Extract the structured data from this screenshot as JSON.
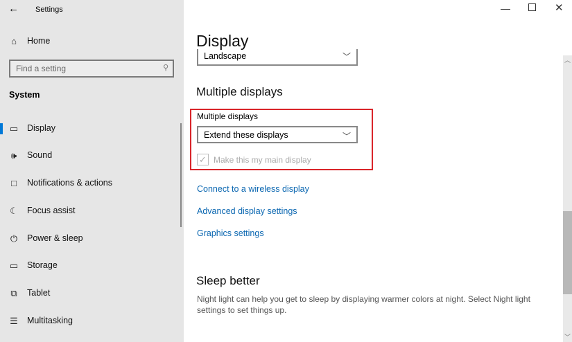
{
  "window": {
    "title": "Settings",
    "back_icon": "arrow-left-icon",
    "minimize_icon": "minimize-icon",
    "maximize_icon": "maximize-icon",
    "close_icon": "close-icon"
  },
  "sidebar": {
    "home": "Home",
    "search_placeholder": "Find a setting",
    "section": "System",
    "items": [
      {
        "label": "Display",
        "icon": "monitor-icon",
        "selected": true
      },
      {
        "label": "Sound",
        "icon": "speaker-icon"
      },
      {
        "label": "Notifications & actions",
        "icon": "notification-icon"
      },
      {
        "label": "Focus assist",
        "icon": "moon-icon"
      },
      {
        "label": "Power & sleep",
        "icon": "power-icon"
      },
      {
        "label": "Storage",
        "icon": "storage-icon"
      },
      {
        "label": "Tablet",
        "icon": "tablet-icon"
      },
      {
        "label": "Multitasking",
        "icon": "multitasking-icon"
      }
    ]
  },
  "main": {
    "title": "Display",
    "orientation_value": "Landscape",
    "multiple_heading": "Multiple displays",
    "multiple_label": "Multiple displays",
    "multiple_value": "Extend these displays",
    "main_display_label": "Make this my main display",
    "main_display_checked": true,
    "links": [
      "Connect to a wireless display",
      "Advanced display settings",
      "Graphics settings"
    ],
    "sleep_heading": "Sleep better",
    "sleep_text": "Night light can help you get to sleep by displaying warmer colors at night. Select Night light settings to set things up.",
    "highlight_color": "#d9252a",
    "accent": "#0078d7"
  }
}
